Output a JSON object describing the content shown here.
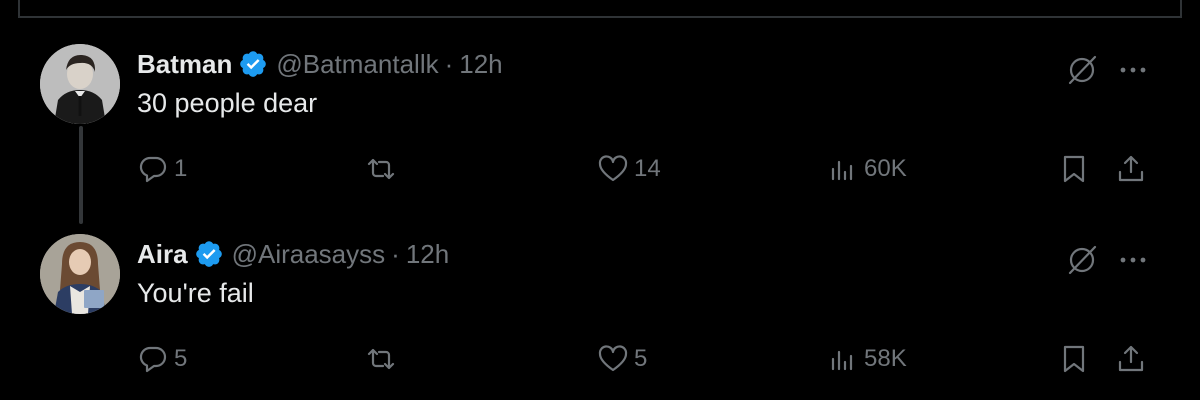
{
  "tweets": [
    {
      "author": {
        "name": "Batman",
        "handle": "@Batmantallk",
        "verified": true,
        "avatar": "avatar-man-in-suit"
      },
      "separator": "·",
      "time": "12h",
      "text": "30 people dear",
      "stats": {
        "replies": "1",
        "retweets": "",
        "likes": "14",
        "views": "60K"
      }
    },
    {
      "author": {
        "name": "Aira",
        "handle": "@Airaasayss",
        "verified": true,
        "avatar": "avatar-woman-with-books"
      },
      "separator": "·",
      "time": "12h",
      "text": "You're fail",
      "stats": {
        "replies": "5",
        "retweets": "",
        "likes": "5",
        "views": "58K"
      }
    }
  ],
  "colors": {
    "background": "#000000",
    "text": "#e7e9ea",
    "muted": "#71767b",
    "verified": "#1d9bf0",
    "border": "#2f3336"
  },
  "icons": [
    "reply-icon",
    "retweet-icon",
    "like-icon",
    "views-icon",
    "bookmark-icon",
    "share-icon",
    "grok-icon",
    "more-icon",
    "verified-badge-icon"
  ]
}
